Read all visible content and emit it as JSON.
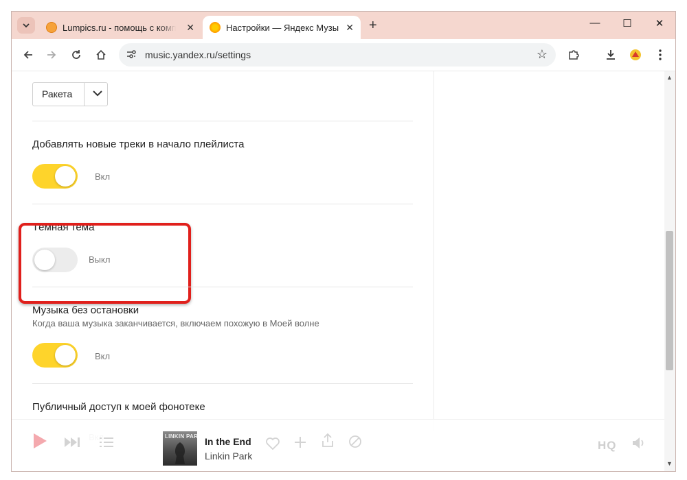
{
  "browser": {
    "tabs": [
      {
        "title": "Lumpics.ru - помощь с компьютером",
        "close": "✕"
      },
      {
        "title": "Настройки — Яндекс Музыка",
        "close": "✕"
      }
    ],
    "new_tab": "+",
    "window_controls": {
      "minimize": "—",
      "maximize": "☐",
      "close": "✕"
    },
    "url": "music.yandex.ru/settings"
  },
  "settings": {
    "dropdown": {
      "value": "Ракета"
    },
    "add_to_start": {
      "label": "Добавлять новые треки в начало плейлиста",
      "state": "Вкл",
      "on": true
    },
    "dark_theme": {
      "label": "Тёмная тема",
      "state": "Выкл",
      "on": false
    },
    "nonstop": {
      "label": "Музыка без остановки",
      "description": "Когда ваша музыка заканчивается, включаем похожую в Моей волне",
      "state": "Вкл",
      "on": true
    },
    "public_access": {
      "label": "Публичный доступ к моей фонотеке",
      "state": "Вкл"
    }
  },
  "player": {
    "cover_text": "LINKIN PARK",
    "track_title": "In the End",
    "artist": "Linkin Park",
    "quality": "HQ"
  },
  "colors": {
    "toggle_on": "#fed42b",
    "toggle_off": "#ececec",
    "highlight": "#e0201c",
    "tab_strip": "#f5d7cf"
  }
}
